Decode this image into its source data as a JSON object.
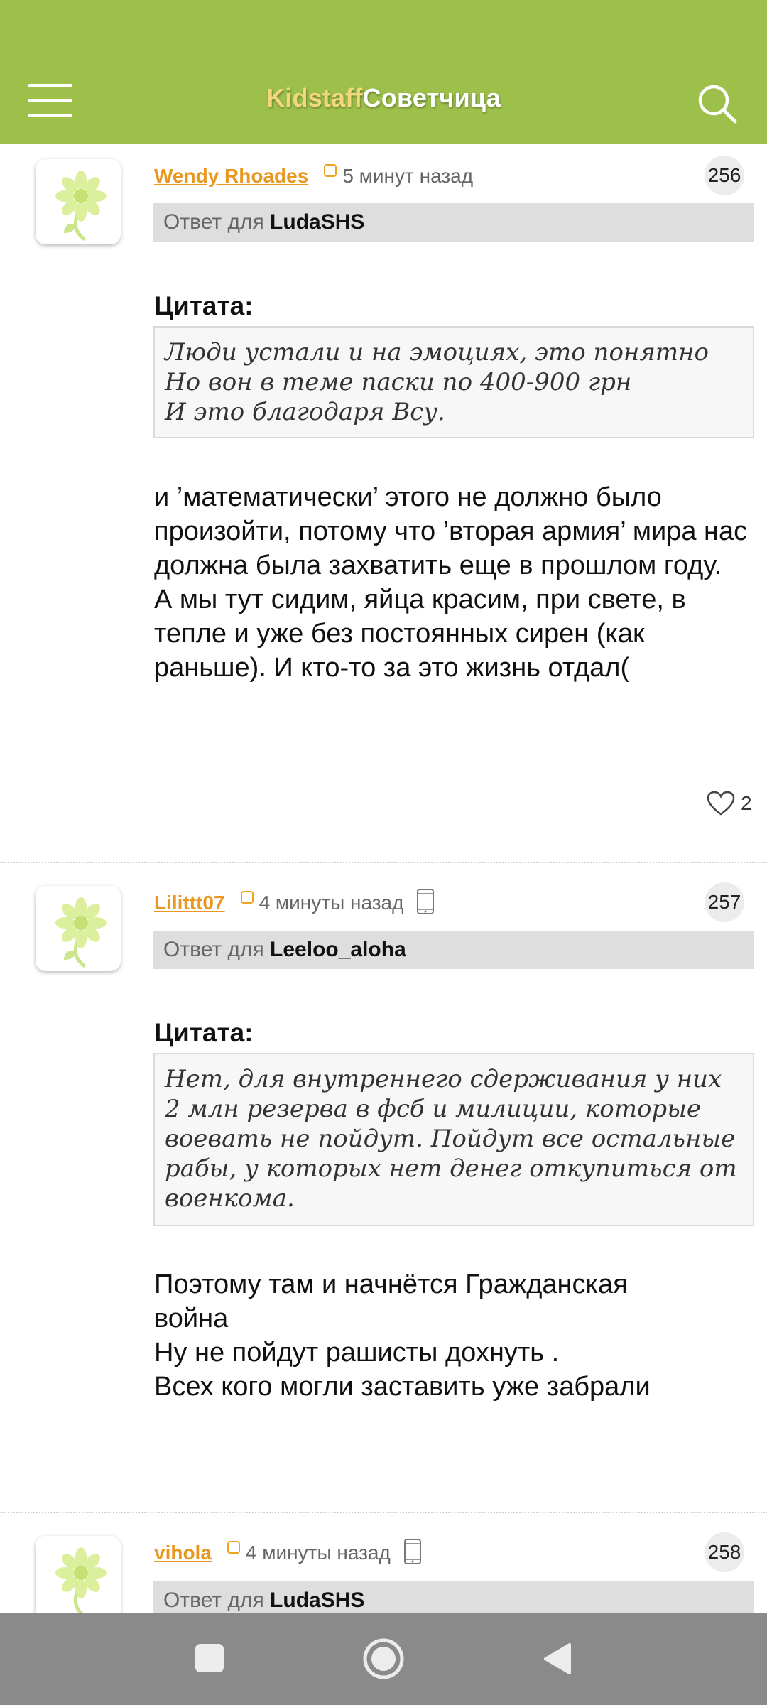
{
  "header": {
    "brand_part1": "Kidstaff",
    "brand_part2": "Советчица",
    "color": "#9cc04a"
  },
  "posts": [
    {
      "author": "Wendy Rhoades",
      "time": "5 минут назад",
      "mobile": false,
      "number": "256",
      "reply_prefix": "Ответ для",
      "reply_to": "LudaSHS",
      "quote_label": "Цитата:",
      "quote_lines": [
        "Люди устали и на эмоциях, это понятно",
        "Но вон в теме паски по 400-900 грн",
        "И это благодаря Всу."
      ],
      "body": "и ’математически’ этого не должно было произойти, потому что ’вторая армия’ мира нас должна была захватить еще в прошлом году.\nА мы тут сидим, яйца красим, при свете, в тепле и уже без постоянных сирен (как раньше). И кто-то за это жизнь отдал(",
      "likes": "2"
    },
    {
      "author": "Lilittt07",
      "time": "4 минуты назад",
      "mobile": true,
      "number": "257",
      "reply_prefix": "Ответ для",
      "reply_to": "Leeloo_aloha",
      "quote_label": "Цитата:",
      "quote_text": "Нет, для внутреннего сдерживания у них 2 млн резерва в фсб и милиции, которые воевать не пойдут. Пойдут все остальные рабы, у которых нет денег откупиться от военкома.",
      "body_lines": [
        "Поэтому там и начнётся Гражданская",
        "война",
        "Ну не пойдут рашисты дохнуть .",
        "Всех кого могли заставить уже забрали"
      ]
    },
    {
      "author": "vihola",
      "time": "4 минуты назад",
      "mobile": true,
      "number": "258",
      "reply_prefix": "Ответ для",
      "reply_to": "LudaSHS"
    }
  ],
  "icons": {
    "menu": "hamburger-icon",
    "search": "search-icon",
    "like": "heart-icon",
    "mobile": "phone-icon",
    "avatar": "flower-icon",
    "nav_recents": "square-icon",
    "nav_home": "circle-icon",
    "nav_back": "triangle-back-icon"
  },
  "colors": {
    "author": "#e8981e",
    "status": "#f0a322",
    "navbar": "#8a8a8a"
  }
}
